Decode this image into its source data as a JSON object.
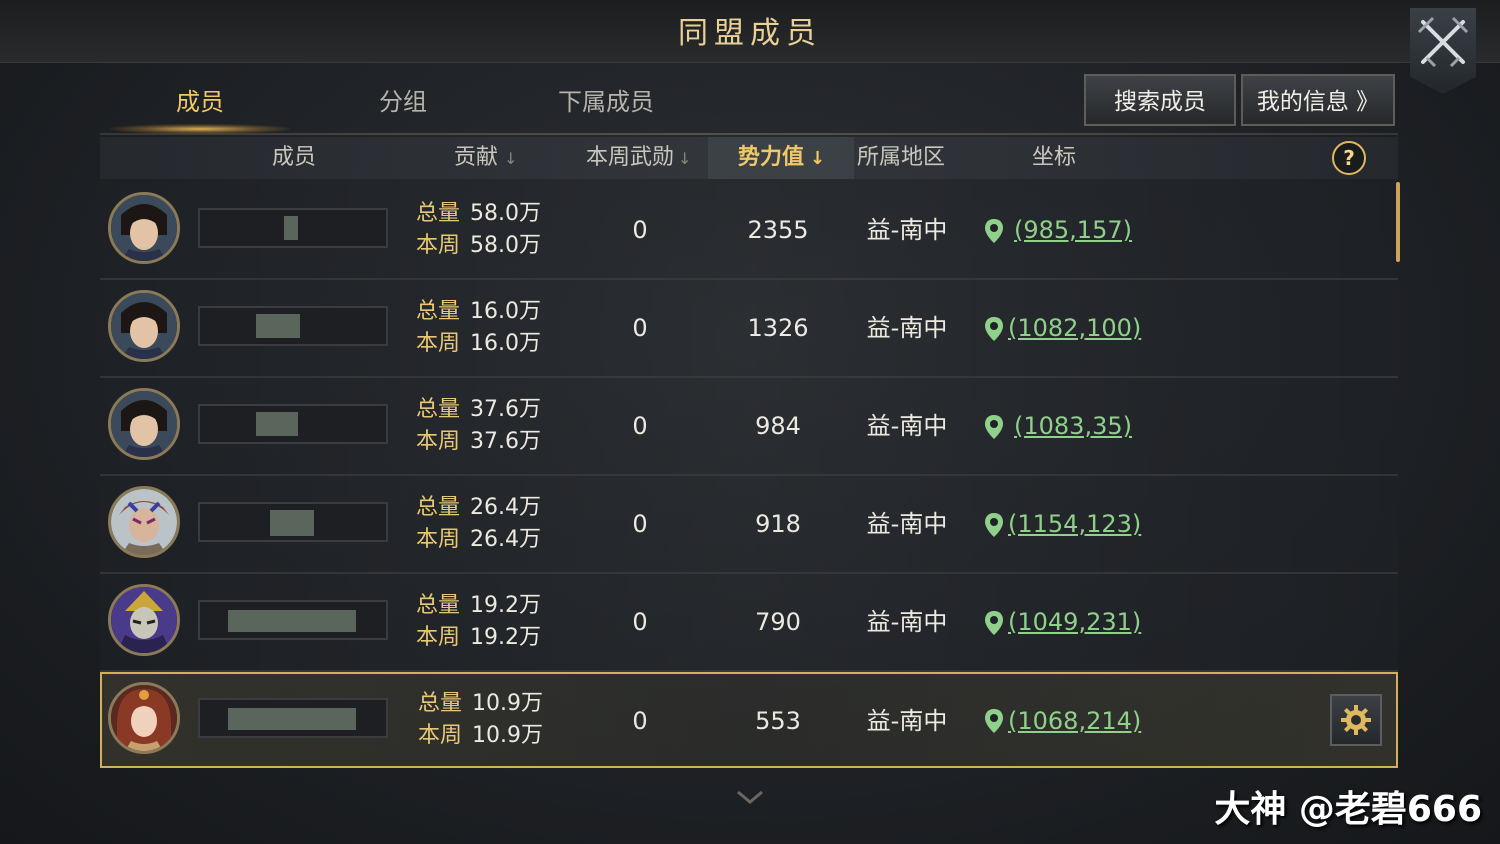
{
  "window": {
    "title": "同盟成员"
  },
  "tabs": [
    {
      "label": "成员",
      "active": true
    },
    {
      "label": "分组",
      "active": false
    },
    {
      "label": "下属成员",
      "active": false
    }
  ],
  "buttons": {
    "search": "搜索成员",
    "my_info": "我的信息 》"
  },
  "columns": {
    "member": "成员",
    "contribution": "贡献",
    "weekly_merit": "本周武勋",
    "power": "势力值",
    "region": "所属地区",
    "coords": "坐标",
    "sort_indicator": "↓",
    "help": "?"
  },
  "labels": {
    "total": "总量",
    "week": "本周"
  },
  "colors": {
    "accent_gold": "#f0c869",
    "coord_green": "#8fd08a",
    "self_border": "#d2b15a"
  },
  "members": [
    {
      "total": "58.0万",
      "week": "58.0万",
      "merit": "0",
      "power": "2355",
      "region": "益-南中",
      "coords": "(985,157)",
      "avatar": "male-swordsman-portrait"
    },
    {
      "total": "16.0万",
      "week": "16.0万",
      "merit": "0",
      "power": "1326",
      "region": "益-南中",
      "coords": "(1082,100)",
      "avatar": "male-swordsman-portrait"
    },
    {
      "total": "37.6万",
      "week": "37.6万",
      "merit": "0",
      "power": "984",
      "region": "益-南中",
      "coords": "(1083,35)",
      "avatar": "male-swordsman-portrait"
    },
    {
      "total": "26.4万",
      "week": "26.4万",
      "merit": "0",
      "power": "918",
      "region": "益-南中",
      "coords": "(1154,123)",
      "avatar": "tribal-warrior-portrait"
    },
    {
      "total": "19.2万",
      "week": "19.2万",
      "merit": "0",
      "power": "790",
      "region": "益-南中",
      "coords": "(1049,231)",
      "avatar": "masked-general-portrait"
    },
    {
      "total": "10.9万",
      "week": "10.9万",
      "merit": "0",
      "power": "553",
      "region": "益-南中",
      "coords": "(1068,214)",
      "avatar": "female-warrior-portrait",
      "self": true
    }
  ],
  "watermark": "大神 @老碧666"
}
